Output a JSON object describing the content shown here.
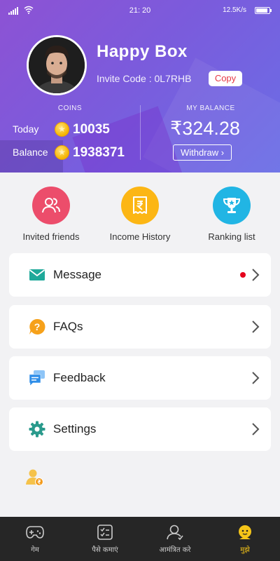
{
  "status_bar": {
    "time": "21: 20",
    "net_speed": "12.5K/s"
  },
  "profile": {
    "name": "Happy Box",
    "invite_label": "Invite Code : 0L7RHB",
    "copy_label": "Copy"
  },
  "coins": {
    "heading": "COINS",
    "today_label": "Today",
    "today_value": "10035",
    "balance_label": "Balance",
    "balance_value": "1938371"
  },
  "wallet": {
    "heading": "MY BALANCE",
    "amount": "₹324.28",
    "withdraw_label": "Withdraw ›"
  },
  "quick_actions": [
    {
      "label": "Invited friends",
      "icon": "friends-icon",
      "color": "#ec4d6b"
    },
    {
      "label": "Income History",
      "icon": "receipt-rupee-icon",
      "color": "#fcb614"
    },
    {
      "label": "Ranking list",
      "icon": "trophy-icon",
      "color": "#21b5e4"
    }
  ],
  "menu": [
    {
      "label": "Message",
      "icon": "mail-icon",
      "has_unread_dot": true
    },
    {
      "label": "FAQs",
      "icon": "question-icon"
    },
    {
      "label": "Feedback",
      "icon": "chat-icon"
    },
    {
      "label": "Settings",
      "icon": "gear-icon"
    }
  ],
  "bottom_nav": [
    {
      "label": "गेम",
      "icon": "gamepad-icon"
    },
    {
      "label": "पैसे कमाएं",
      "icon": "checklist-icon"
    },
    {
      "label": "आमंत्रित करे",
      "icon": "person-icon"
    },
    {
      "label": "मुझे",
      "icon": "me-icon",
      "active": true
    }
  ],
  "colors": {
    "header_start": "#8d52d4",
    "header_end": "#6a6ee6",
    "accent_red": "#e63946",
    "nav_active": "#f5c518",
    "nav_bg": "#262626"
  }
}
